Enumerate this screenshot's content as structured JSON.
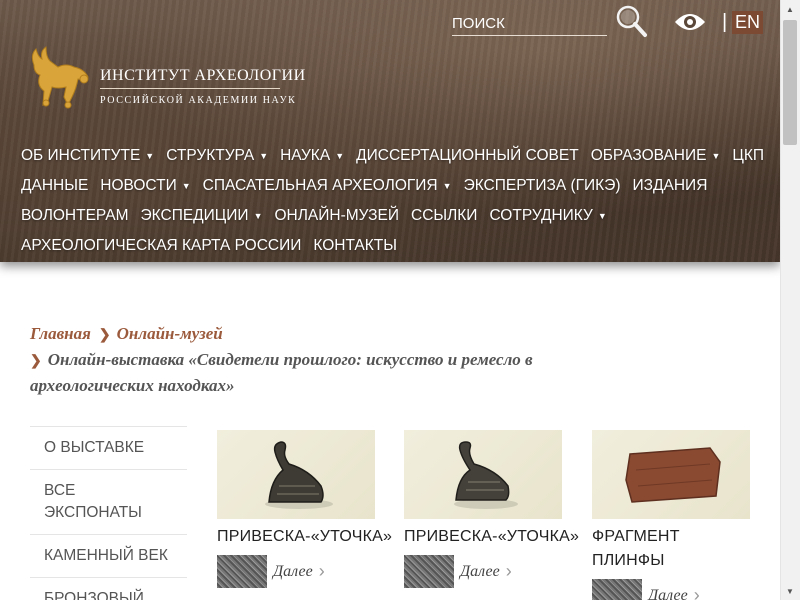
{
  "header": {
    "search": {
      "placeholder": "поиск"
    },
    "lang": "EN",
    "lang_separator": "|",
    "logo": {
      "title": "ИНСТИТУТ АРХЕОЛОГИИ",
      "subtitle": "РОССИЙСКОЙ АКАДЕМИИ НАУК"
    },
    "nav_rows": [
      [
        {
          "label": "ОБ ИНСТИТУТЕ",
          "dropdown": true
        },
        {
          "label": "СТРУКТУРА",
          "dropdown": true
        },
        {
          "label": "НАУКА",
          "dropdown": true
        },
        {
          "label": "ДИССЕРТАЦИОННЫЙ СОВЕТ",
          "dropdown": false
        },
        {
          "label": "ОБРАЗОВАНИЕ",
          "dropdown": true
        },
        {
          "label": "ЦКП",
          "dropdown": false
        }
      ],
      [
        {
          "label": "ДАННЫЕ",
          "dropdown": false
        },
        {
          "label": "НОВОСТИ",
          "dropdown": true
        },
        {
          "label": "СПАСАТЕЛЬНАЯ АРХЕОЛОГИЯ",
          "dropdown": true
        },
        {
          "label": "ЭКСПЕРТИЗА (ГИКЭ)",
          "dropdown": false
        },
        {
          "label": "ИЗДАНИЯ",
          "dropdown": false
        }
      ],
      [
        {
          "label": "ВОЛОНТЕРАМ",
          "dropdown": false
        },
        {
          "label": "ЭКСПЕДИЦИИ",
          "dropdown": true
        },
        {
          "label": "ОНЛАЙН-МУЗЕЙ",
          "dropdown": false
        },
        {
          "label": "ССЫЛКИ",
          "dropdown": false
        },
        {
          "label": "СОТРУДНИКУ",
          "dropdown": true
        }
      ],
      [
        {
          "label": "АРХЕОЛОГИЧЕСКАЯ КАРТА РОССИИ",
          "dropdown": false
        },
        {
          "label": "КОНТАКТЫ",
          "dropdown": false
        }
      ]
    ]
  },
  "breadcrumb": {
    "home": "Главная",
    "museum": "Онлайн-музей",
    "current": "Онлайн-выставка «Свидетели прошлого: искусство и ремесло в археологических находках»"
  },
  "sidebar": {
    "items": [
      "О выставке",
      "Все экспонаты",
      "Каменный век",
      "Бронзовый"
    ]
  },
  "cards": [
    {
      "title": "ПРИВЕСКА-«УТОЧКА»",
      "more": "Далее"
    },
    {
      "title": "ПРИВЕСКА-«УТОЧКА»",
      "more": "Далее"
    },
    {
      "title": "ФРАГМЕНТ ПЛИНФЫ",
      "more": "Далее"
    }
  ],
  "colors": {
    "accent": "#9b5a3c",
    "lang_bg": "#7c4a32",
    "header_bg": "#5a4739"
  },
  "icons": [
    "search-icon",
    "eye-icon",
    "logo-deer-icon",
    "chevron-right-icon",
    "caret-down-icon"
  ]
}
